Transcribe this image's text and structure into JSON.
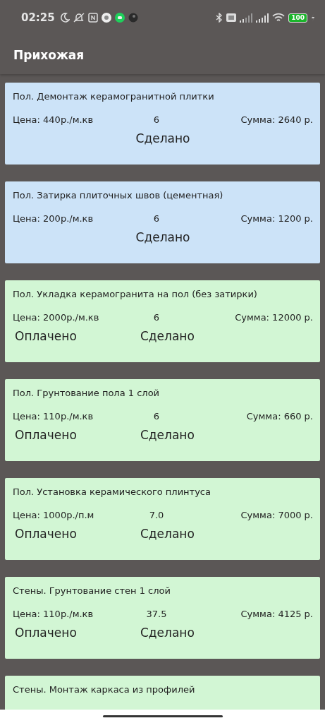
{
  "status_bar": {
    "time": "02:25",
    "battery": "100"
  },
  "toolbar": {
    "title": "Прихожая"
  },
  "items": [
    {
      "kind": "done",
      "title": "Пол. Демонтаж керамогранитной плитки",
      "price": "Цена: 440р./м.кв",
      "qty": "6",
      "sum": "Сумма: 2640 р.",
      "done_label": "Сделано"
    },
    {
      "kind": "done",
      "title": "Пол. Затирка плиточных швов (цементная)",
      "price": "Цена: 200р./м.кв",
      "qty": "6",
      "sum": "Сумма: 1200 р.",
      "done_label": "Сделано"
    },
    {
      "kind": "paid",
      "title": "Пол. Укладка керамогранита на пол (без затирки)",
      "price": "Цена: 2000р./м.кв",
      "qty": "6",
      "sum": "Сумма: 12000 р.",
      "paid_label": "Оплачено",
      "done_label": "Сделано"
    },
    {
      "kind": "paid",
      "title": "Пол. Грунтование пола 1 слой",
      "price": "Цена: 110р./м.кв",
      "qty": "6",
      "sum": "Сумма: 660 р.",
      "paid_label": "Оплачено",
      "done_label": "Сделано"
    },
    {
      "kind": "paid",
      "title": "Пол. Установка керамического плинтуса",
      "price": "Цена: 1000р./п.м",
      "qty": "7.0",
      "sum": "Сумма: 7000 р.",
      "paid_label": "Оплачено",
      "done_label": "Сделано"
    },
    {
      "kind": "paid",
      "title": "Стены. Грунтование стен 1 слой",
      "price": "Цена: 110р./м.кв",
      "qty": "37.5",
      "sum": "Сумма: 4125 р.",
      "paid_label": "Оплачено",
      "done_label": "Сделано"
    },
    {
      "kind": "paid",
      "title": "Стены. Монтаж каркаса из профилей"
    }
  ]
}
